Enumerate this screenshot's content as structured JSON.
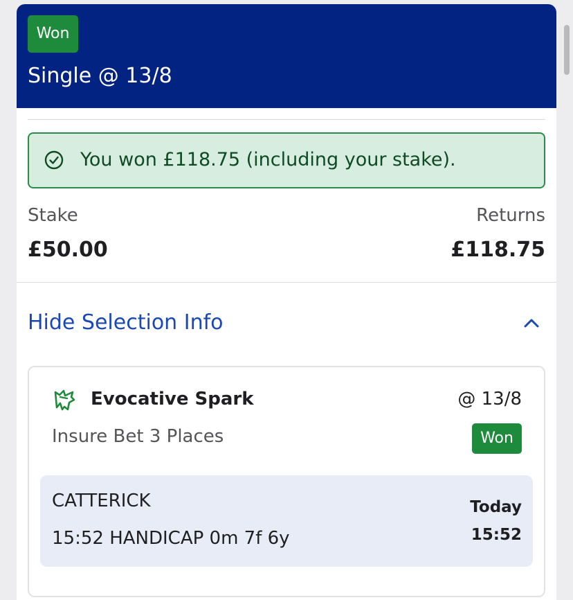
{
  "colors": {
    "header_bg": "#022381",
    "won_badge": "#1e8a3c",
    "banner_bg": "#d7ede0",
    "banner_border": "#2b8a47",
    "link_blue": "#1c48b6",
    "event_box_bg": "#e8ecf7"
  },
  "bet": {
    "status_badge": "Won",
    "title": "Single @ 13/8",
    "win_message": "You won £118.75 (including your stake).",
    "stake_label": "Stake",
    "stake_value": "£50.00",
    "returns_label": "Returns",
    "returns_value": "£118.75",
    "toggle_label": "Hide Selection Info"
  },
  "selection": {
    "icon": "horse-icon",
    "runner": "Evocative Spark",
    "odds": "@ 13/8",
    "market": "Insure Bet 3 Places",
    "status_badge": "Won",
    "course": "CATTERICK",
    "race": "15:52 HANDICAP 0m 7f 6y",
    "day": "Today",
    "time": "15:52"
  }
}
